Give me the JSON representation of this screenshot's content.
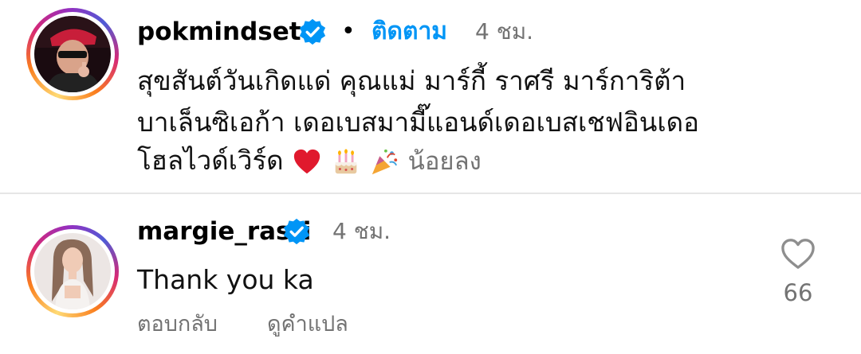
{
  "comment": {
    "username": "pokmindset",
    "separator": "•",
    "follow_label": "ติดตาม",
    "time": "4 ชม.",
    "lines": [
      "สุขสันต์วันเกิดแด่ คุณแม่ มาร์กี้ ราศรี มาร์การิต้า",
      "บาเล็นซิเอก้า เดอเบสมามี๊แอนด์เดอเบสเชฟอินเดอ",
      "โฮลไวด์เวิร์ด"
    ],
    "emojis": [
      "heart-emoji",
      "birthday-cake-emoji",
      "party-popper-emoji"
    ],
    "collapse_label": "น้อยลง"
  },
  "reply": {
    "username": "margie_rasri",
    "time": "4 ชม.",
    "text": "Thank you ka",
    "reply_label": "ตอบกลับ",
    "translate_label": "ดูคำแปล",
    "like_count": "66"
  },
  "colors": {
    "follow": "#0095f6",
    "verified": "#0095f6",
    "secondary_text": "#737373",
    "divider": "#e6e6e6"
  },
  "icons": [
    "verified-badge-icon",
    "heart-outline-icon"
  ]
}
